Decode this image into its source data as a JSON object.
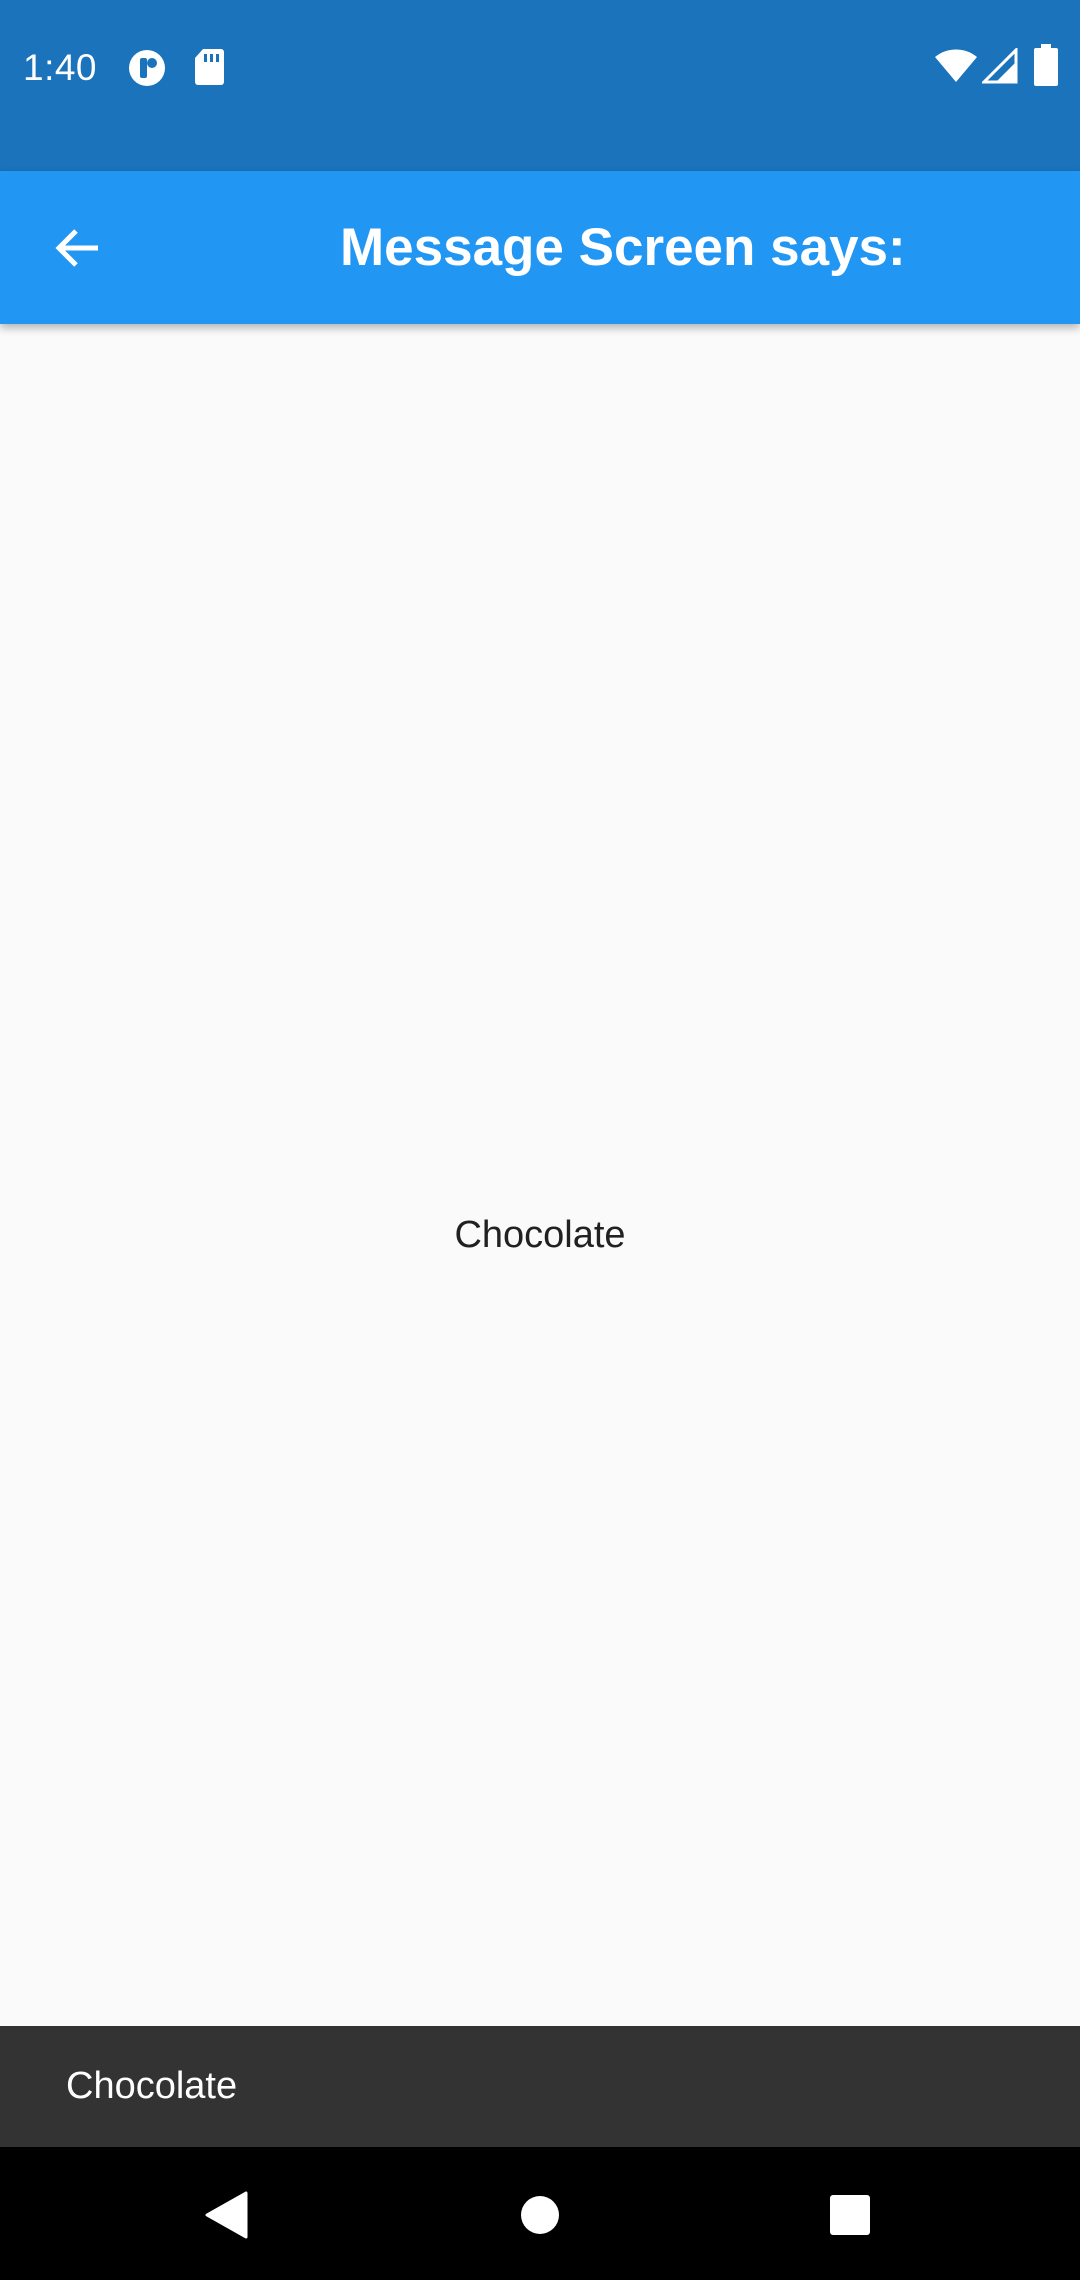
{
  "status_bar": {
    "time": "1:40",
    "icons": [
      "data-saver-icon",
      "sd-card-icon",
      "wifi-icon",
      "cell-signal-icon",
      "battery-icon"
    ]
  },
  "app_bar": {
    "title": "Message Screen says:",
    "back_icon": "arrow-back-icon",
    "color": "#2196f3"
  },
  "main": {
    "message": "Chocolate"
  },
  "snackbar": {
    "text": "Chocolate"
  },
  "nav_bar": {
    "buttons": [
      "back-icon",
      "home-icon",
      "recents-icon"
    ]
  },
  "colors": {
    "status_bar": "#1a73bb",
    "app_bar": "#2196f3",
    "background": "#fafafa",
    "snackbar": "#333333",
    "nav_bar": "#000000"
  }
}
